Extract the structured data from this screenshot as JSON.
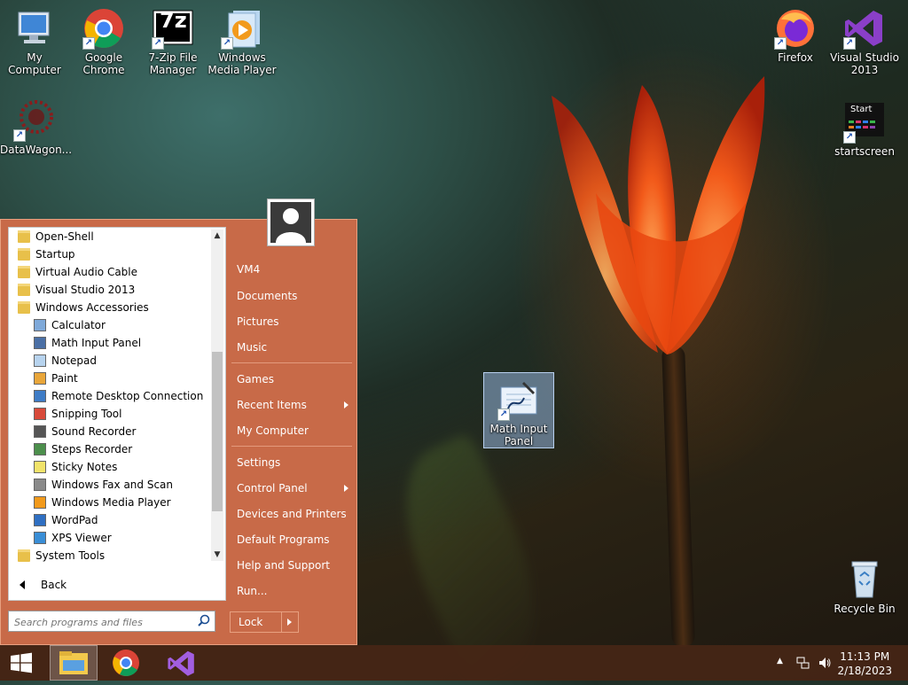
{
  "desktop": {
    "icons": [
      {
        "label": "My Computer"
      },
      {
        "label": "Google Chrome"
      },
      {
        "label": "7-Zip File Manager"
      },
      {
        "label": "Windows Media Player"
      },
      {
        "label": "Firefox"
      },
      {
        "label": "Visual Studio 2013"
      },
      {
        "label": "DataWagon..."
      },
      {
        "label": "startscreen"
      },
      {
        "label": "Math Input Panel"
      },
      {
        "label": "Recycle Bin"
      }
    ],
    "startscreen_thumb_text": "Start",
    "sevenzip_logo_text": "7z"
  },
  "start_menu": {
    "programs": [
      {
        "label": "Open-Shell",
        "icon": "folder-icon"
      },
      {
        "label": "Startup",
        "icon": "folder-icon"
      },
      {
        "label": "Virtual Audio Cable",
        "icon": "folder-icon"
      },
      {
        "label": "Visual Studio 2013",
        "icon": "folder-icon"
      },
      {
        "label": "Windows Accessories",
        "icon": "folder-icon"
      },
      {
        "label": "Calculator",
        "icon": "calculator-icon"
      },
      {
        "label": "Math Input Panel",
        "icon": "math-input-icon"
      },
      {
        "label": "Notepad",
        "icon": "notepad-icon"
      },
      {
        "label": "Paint",
        "icon": "paint-icon"
      },
      {
        "label": "Remote Desktop Connection",
        "icon": "remote-desktop-icon"
      },
      {
        "label": "Snipping Tool",
        "icon": "snipping-tool-icon"
      },
      {
        "label": "Sound Recorder",
        "icon": "microphone-icon"
      },
      {
        "label": "Steps Recorder",
        "icon": "steps-recorder-icon"
      },
      {
        "label": "Sticky Notes",
        "icon": "sticky-notes-icon"
      },
      {
        "label": "Windows Fax and Scan",
        "icon": "fax-icon"
      },
      {
        "label": "Windows Media Player",
        "icon": "media-player-icon"
      },
      {
        "label": "WordPad",
        "icon": "wordpad-icon"
      },
      {
        "label": "XPS Viewer",
        "icon": "xps-viewer-icon"
      },
      {
        "label": "System Tools",
        "icon": "folder-icon"
      }
    ],
    "back_label": "Back",
    "search_placeholder": "Search programs and files",
    "right_items": [
      {
        "label": "VM4"
      },
      {
        "label": "Documents"
      },
      {
        "label": "Pictures"
      },
      {
        "label": "Music"
      },
      {
        "label": "Games"
      },
      {
        "label": "Recent Items"
      },
      {
        "label": "My Computer"
      },
      {
        "label": "Settings"
      },
      {
        "label": "Control Panel"
      },
      {
        "label": "Devices and Printers"
      },
      {
        "label": "Default Programs"
      },
      {
        "label": "Help and Support"
      },
      {
        "label": "Run..."
      }
    ],
    "lock_label": "Lock",
    "accent_color": "#c86a48"
  },
  "taskbar": {
    "time": "11:13 PM",
    "date": "2/18/2023"
  }
}
